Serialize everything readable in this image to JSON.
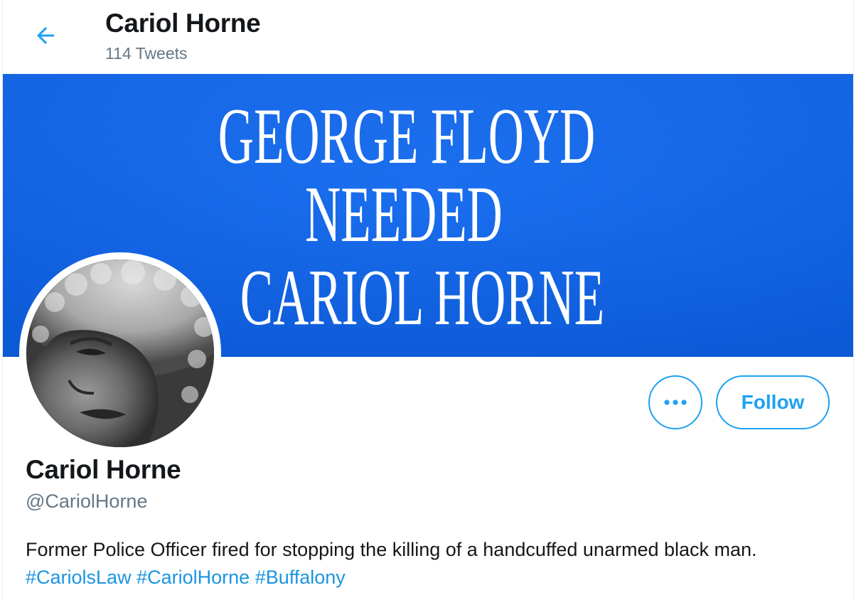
{
  "header": {
    "name": "Cariol Horne",
    "tweet_count": "114 Tweets"
  },
  "banner": {
    "lines": [
      "GEORGE FLOYD",
      "NEEDED",
      "CARIOL HORNE"
    ]
  },
  "actions": {
    "more_label": "•••",
    "follow_label": "Follow"
  },
  "profile": {
    "name": "Cariol Horne",
    "handle": "@CariolHorne",
    "bio_text": "Former Police Officer fired for stopping the killing of a handcuffed unarmed black man.",
    "hashtags": [
      "#CariolsLaw",
      "#CariolHorne",
      "#Buffalony"
    ]
  },
  "colors": {
    "accent": "#1da1f2",
    "hashtag": "#1b95e0",
    "banner_blue": "#1267ea",
    "text_primary": "#14171a",
    "text_secondary": "#657786"
  },
  "icons": {
    "back": "arrow-left-icon",
    "more": "more-horizontal-icon"
  }
}
